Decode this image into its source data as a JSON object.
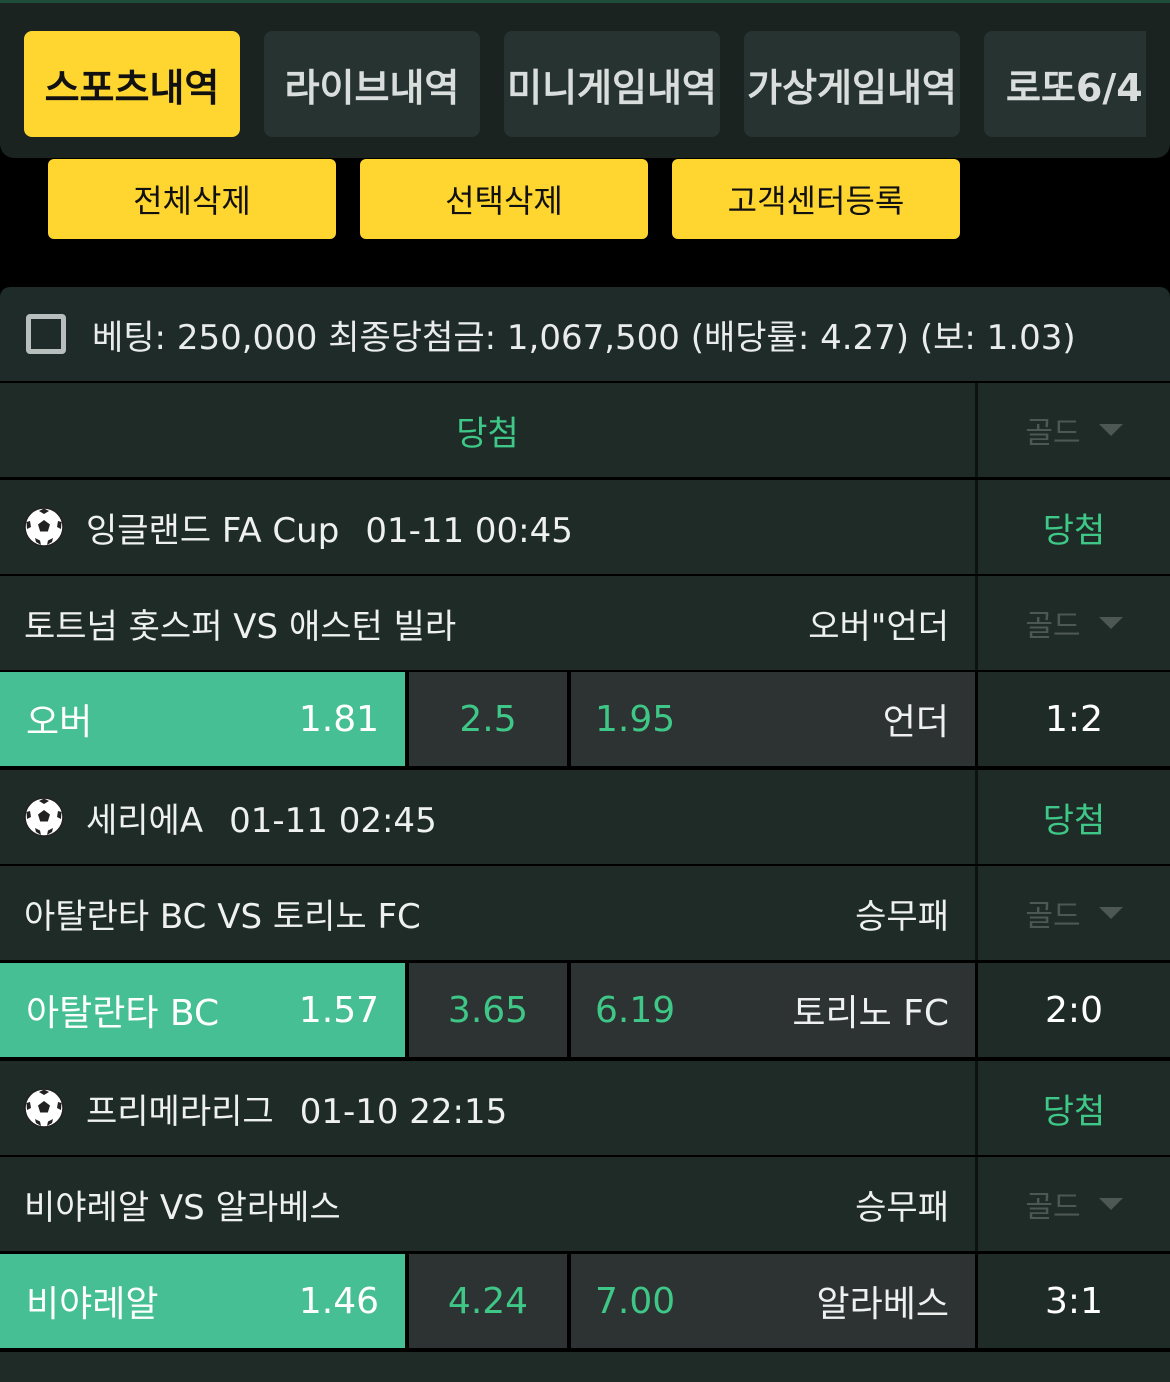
{
  "tabs": [
    "스포츠내역",
    "라이브내역",
    "미니게임내역",
    "가상게임내역",
    "로또6/4"
  ],
  "actions": {
    "delete_all": "전체삭제",
    "delete_selected": "선택삭제",
    "customer_center": "고객센터등록"
  },
  "bet": {
    "summary": "베팅: 250,000 최종당첨금: 1,067,500 (배당률: 4.27) (보: 1.03)",
    "result": "당첨",
    "gold_label": "골드"
  },
  "games": [
    {
      "league": "잉글랜드 FA Cup",
      "time": "01-11 00:45",
      "status": "당첨",
      "teams": "토트넘 홋스퍼 VS 애스턴 빌라",
      "bet_type": "오버\"언더",
      "gold_label": "골드",
      "home_label": "오버",
      "home_odds": "1.81",
      "draw": "2.5",
      "away_odds": "1.95",
      "away_label": "언더",
      "score": "1:2"
    },
    {
      "league": "세리에A",
      "time": "01-11 02:45",
      "status": "당첨",
      "teams": "아탈란타 BC VS 토리노 FC",
      "bet_type": "승무패",
      "gold_label": "골드",
      "home_label": "아탈란타 BC",
      "home_odds": "1.57",
      "draw": "3.65",
      "away_odds": "6.19",
      "away_label": "토리노 FC",
      "score": "2:0"
    },
    {
      "league": "프리메라리그",
      "time": "01-10 22:15",
      "status": "당첨",
      "teams": "비야레알 VS 알라베스",
      "bet_type": "승무패",
      "gold_label": "골드",
      "home_label": "비야레알",
      "home_odds": "1.46",
      "draw": "4.24",
      "away_odds": "7.00",
      "away_label": "알라베스",
      "score": "3:1"
    }
  ],
  "colors": {
    "accent_yellow": "#ffd630",
    "win_green": "#3ec787",
    "selected_odds": "#45bf93"
  },
  "icons": {
    "sport": "soccer-ball-icon",
    "dropdown": "chevron-down-icon"
  }
}
